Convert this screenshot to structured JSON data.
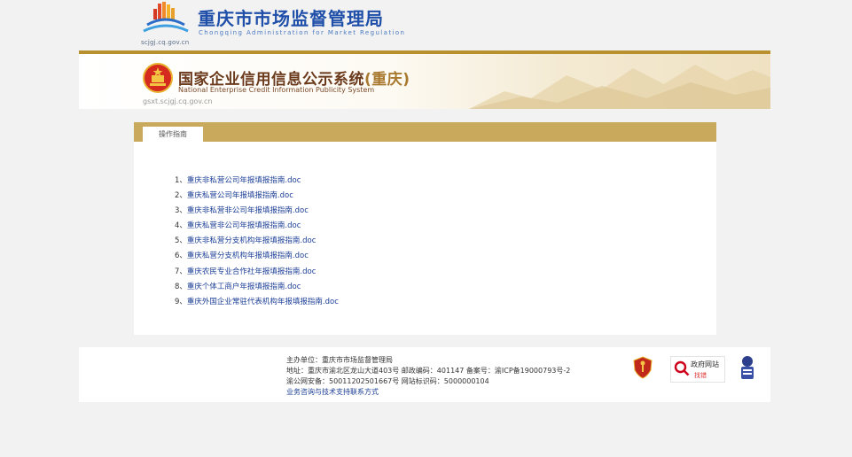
{
  "header": {
    "title": "重庆市市场监督管理局",
    "subtitle": "Chongqing  Administration for Market Regulation",
    "domain": "scjgj.cq.gov.cn"
  },
  "banner": {
    "title": "国家企业信用信息公示系统",
    "title_region": "(重庆)",
    "subtitle": "National Enterprise Credit Information Publicity System",
    "domain": "gsxt.scjgj.cq.gov.cn"
  },
  "tab": {
    "label": "操作指南"
  },
  "guides": [
    {
      "num": "1、",
      "label": "重庆非私营公司年报填报指南.doc"
    },
    {
      "num": "2、",
      "label": "重庆私营公司年报填报指南.doc"
    },
    {
      "num": "3、",
      "label": "重庆非私营非公司年报填报指南.doc"
    },
    {
      "num": "4、",
      "label": "重庆私营非公司年报填报指南.doc"
    },
    {
      "num": "5、",
      "label": "重庆非私营分支机构年报填报指南.doc"
    },
    {
      "num": "6、",
      "label": "重庆私营分支机构年报填报指南.doc"
    },
    {
      "num": "7、",
      "label": "重庆农民专业合作社年报填报指南.doc"
    },
    {
      "num": "8、",
      "label": "重庆个体工商户年报填报指南.doc"
    },
    {
      "num": "9、",
      "label": "重庆外国企业常驻代表机构年报填报指南.doc"
    }
  ],
  "footer": {
    "sponsor": "主办单位：重庆市市场监督管理局",
    "address": "地址：重庆市渝北区龙山大道403号 邮政编码：401147 备案号：渝ICP备19000793号-2",
    "security": "渝公网安备：50011202501667号 网站标识码：5000000104",
    "support_link": "业务咨询与技术支持联系方式",
    "gov_badge_line1": "政府网站",
    "gov_badge_line2": "找错"
  },
  "colors": {
    "gold": "#b8902e",
    "tab_bar": "#c9a95b",
    "link": "#1b3e96",
    "title_blue": "#1f4fa8",
    "banner_brown": "#6b3a1c"
  },
  "icons": [
    "smr-logo-icon",
    "national-emblem-icon",
    "police-badge-icon",
    "gov-website-search-icon",
    "site-badge-icon"
  ]
}
